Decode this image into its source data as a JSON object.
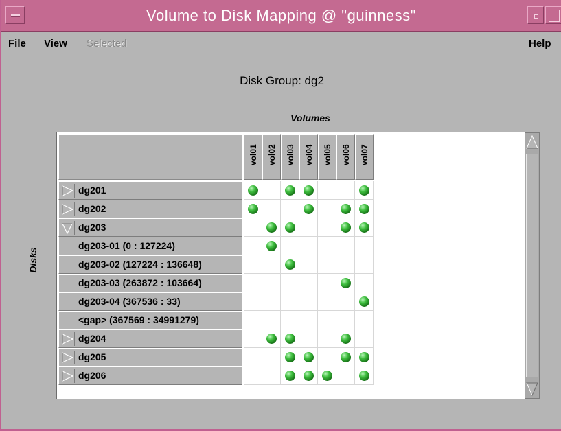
{
  "window": {
    "title": "Volume to Disk Mapping @ \"guinness\"",
    "accent_color": "#c46a91",
    "background_color": "#b5b5b5"
  },
  "menubar": {
    "file": "File",
    "view": "View",
    "selected": "Selected",
    "help": "Help"
  },
  "group_title": "Disk Group: dg2",
  "volumes_label": "Volumes",
  "disks_label": "Disks",
  "volumes": [
    "vol01",
    "vol02",
    "vol03",
    "vol04",
    "vol05",
    "vol06",
    "vol07"
  ],
  "rows": [
    {
      "label": "dg201",
      "kind": "disk",
      "expanded": false,
      "mapped": [
        1,
        0,
        1,
        1,
        0,
        0,
        1
      ]
    },
    {
      "label": "dg202",
      "kind": "disk",
      "expanded": false,
      "mapped": [
        1,
        0,
        0,
        1,
        0,
        1,
        1
      ]
    },
    {
      "label": "dg203",
      "kind": "disk",
      "expanded": true,
      "mapped": [
        0,
        1,
        1,
        0,
        0,
        1,
        1
      ]
    },
    {
      "label": "dg203-01 (0 : 127224)",
      "kind": "subdisk",
      "mapped": [
        0,
        1,
        0,
        0,
        0,
        0,
        0
      ]
    },
    {
      "label": "dg203-02 (127224 : 136648)",
      "kind": "subdisk",
      "mapped": [
        0,
        0,
        1,
        0,
        0,
        0,
        0
      ]
    },
    {
      "label": "dg203-03 (263872 : 103664)",
      "kind": "subdisk",
      "mapped": [
        0,
        0,
        0,
        0,
        0,
        1,
        0
      ]
    },
    {
      "label": "dg203-04 (367536 : 33)",
      "kind": "subdisk",
      "mapped": [
        0,
        0,
        0,
        0,
        0,
        0,
        1
      ]
    },
    {
      "label": "<gap> (367569 : 34991279)",
      "kind": "subdisk",
      "mapped": [
        0,
        0,
        0,
        0,
        0,
        0,
        0
      ]
    },
    {
      "label": "dg204",
      "kind": "disk",
      "expanded": false,
      "mapped": [
        0,
        1,
        1,
        0,
        0,
        1,
        0
      ]
    },
    {
      "label": "dg205",
      "kind": "disk",
      "expanded": false,
      "mapped": [
        0,
        0,
        1,
        1,
        0,
        1,
        1
      ]
    },
    {
      "label": "dg206",
      "kind": "disk",
      "expanded": false,
      "mapped": [
        0,
        0,
        1,
        1,
        1,
        0,
        1
      ]
    }
  ],
  "icons": {
    "expand": "triangle-right-icon",
    "collapse": "triangle-down-icon",
    "mapped": "green-ball-icon"
  }
}
